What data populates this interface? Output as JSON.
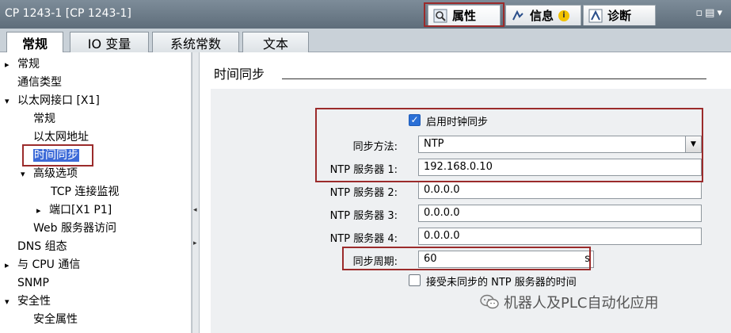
{
  "window": {
    "title": "CP 1243-1 [CP 1243-1]",
    "controls": "▫▤▾"
  },
  "panel_tabs": [
    {
      "label": "属性",
      "icon": "properties-icon"
    },
    {
      "label": "信息",
      "icon": "info-icon",
      "badge": "i"
    },
    {
      "label": "诊断",
      "icon": "diagnostics-icon"
    }
  ],
  "sub_tabs": [
    "常规",
    "IO 变量",
    "系统常数",
    "文本"
  ],
  "tree": [
    {
      "label": "常规",
      "arrow": "▸"
    },
    {
      "label": "通信类型"
    },
    {
      "label": "以太网接口 [X1]",
      "arrow": "▾"
    },
    {
      "label": "常规"
    },
    {
      "label": "以太网地址"
    },
    {
      "label": "时间同步",
      "selected": true
    },
    {
      "label": "高级选项",
      "arrow": "▾"
    },
    {
      "label": "TCP 连接监视"
    },
    {
      "label": "端口[X1 P1]",
      "arrow": "▸"
    },
    {
      "label": "Web 服务器访问"
    },
    {
      "label": "DNS 组态"
    },
    {
      "label": "与 CPU 通信",
      "arrow": "▸"
    },
    {
      "label": "SNMP"
    },
    {
      "label": "安全性",
      "arrow": "▾"
    },
    {
      "label": "安全属性"
    }
  ],
  "section": {
    "title": "时间同步"
  },
  "form": {
    "enable_clock_sync": {
      "label": "启用时钟同步",
      "checked": true
    },
    "sync_method": {
      "label": "同步方法:",
      "value": "NTP"
    },
    "ntp1": {
      "label": "NTP 服务器 1:",
      "value": "192.168.0.10"
    },
    "ntp2": {
      "label": "NTP 服务器 2:",
      "value": "0.0.0.0"
    },
    "ntp3": {
      "label": "NTP 服务器 3:",
      "value": "0.0.0.0"
    },
    "ntp4": {
      "label": "NTP 服务器 4:",
      "value": "0.0.0.0"
    },
    "sync_period": {
      "label": "同步周期:",
      "value": "60",
      "unit": "s"
    },
    "accept_unsync": {
      "label": "接受未同步的 NTP 服务器的时间",
      "checked": false
    }
  },
  "watermark": "机器人及PLC自动化应用",
  "colors": {
    "highlight": "#9b2b2b",
    "selection": "#3c6ad8",
    "checkbox": "#2a6fd6"
  }
}
